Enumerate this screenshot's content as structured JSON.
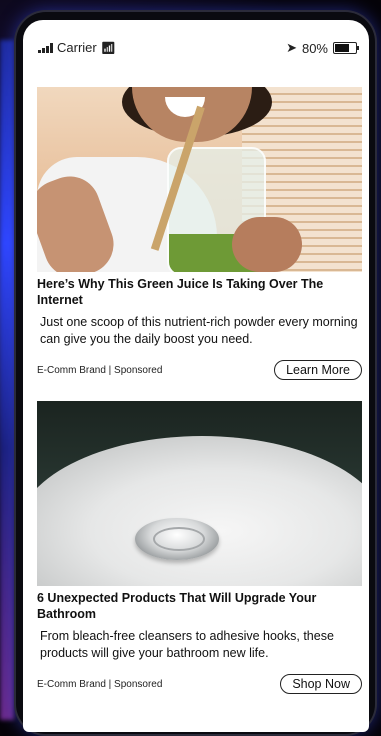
{
  "status_bar": {
    "carrier": "Carrier",
    "wifi_icon": "wifi-icon",
    "signal_icon": "signal-bars-icon",
    "location_icon": "location-arrow-icon",
    "battery_percent": "80%",
    "battery_level": 0.8
  },
  "ads": [
    {
      "title": "Here’s Why This Green Juice Is Taking Over The Internet",
      "description": "Just one scoop of this nutrient-rich powder every morning can give you the daily boost you need.",
      "source": "E-Comm Brand | Sponsored",
      "cta": "Learn More"
    },
    {
      "title": "6 Unexpected Products That Will Upgrade Your Bathroom",
      "description": "From bleach-free cleansers to adhesive hooks, these products will give your bathroom new life.",
      "source": "E-Comm Brand | Sponsored",
      "cta": "Shop Now"
    }
  ]
}
